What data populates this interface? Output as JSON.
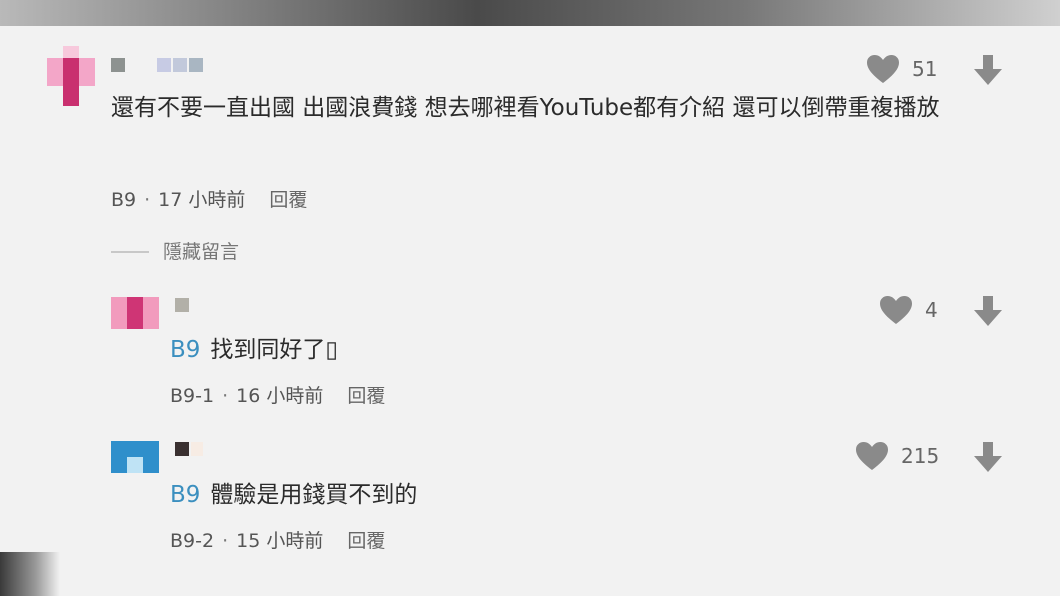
{
  "comments": [
    {
      "text": "還有不要一直出國 出國浪費錢 想去哪裡看YouTube都有介紹 還可以倒帶重複播放",
      "tag": "",
      "id": "B9",
      "time": "17 小時前",
      "reply": "回覆",
      "likes": "51",
      "avatar_colors": [
        "#f3a6c8",
        "#c9306f",
        "#f7c9dc"
      ]
    },
    {
      "text": "找到同好了▯",
      "tag": "B9",
      "id": "B9-1",
      "time": "16 小時前",
      "reply": "回覆",
      "likes": "4",
      "avatar_colors": [
        "#f29bbd",
        "#cf3575"
      ]
    },
    {
      "text": "體驗是用錢買不到的",
      "tag": "B9",
      "id": "B9-2",
      "time": "15 小時前",
      "reply": "回覆",
      "likes": "215",
      "avatar_colors": [
        "#2f8fcb",
        "#bfe3f5"
      ]
    }
  ],
  "hide_comments": "隱藏留言",
  "colors": {
    "background": "#f2f2f2",
    "tag": "#3b8fbf",
    "icon": "#8a8a8a"
  },
  "icons": [
    "heart-icon",
    "arrow-down-icon"
  ]
}
